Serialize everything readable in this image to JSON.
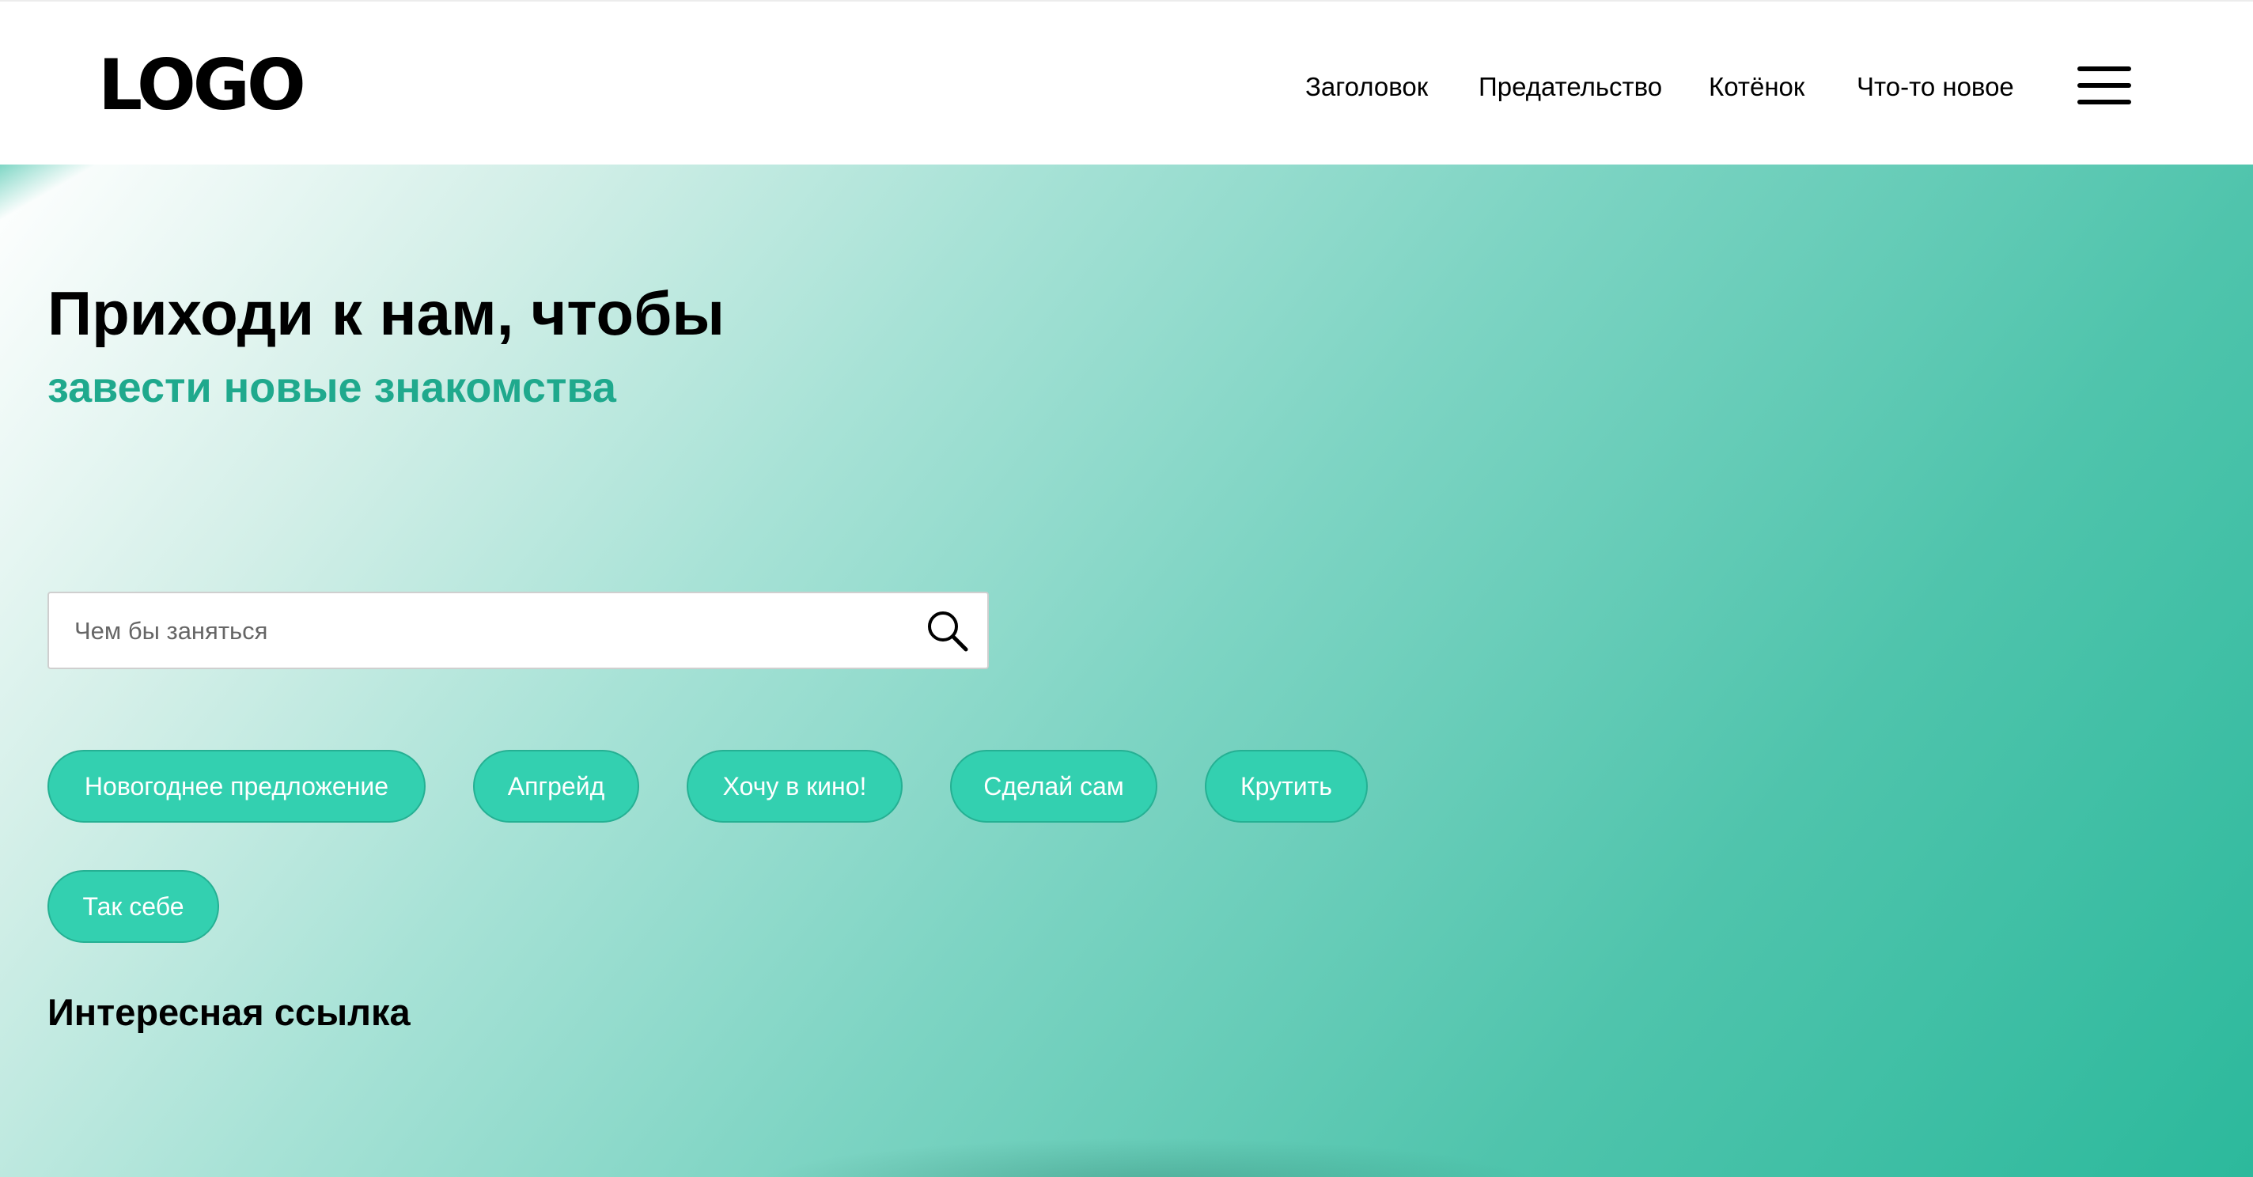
{
  "header": {
    "logo": "LOGO",
    "nav": [
      {
        "label": "Заголовок"
      },
      {
        "label": "Предательство"
      },
      {
        "label": "Котёнок"
      },
      {
        "label": "Что-то новое"
      }
    ],
    "menu_icon": "hamburger-menu-icon"
  },
  "hero": {
    "title": "Приходи к нам, чтобы",
    "subtitle": "завести новые знакомства",
    "search": {
      "placeholder": "Чем бы заняться",
      "value": "",
      "icon": "search-icon"
    },
    "tags": [
      {
        "label": "Новогоднее предложение"
      },
      {
        "label": "Апгрейд"
      },
      {
        "label": "Хочу в кино!"
      },
      {
        "label": "Сделай сам"
      },
      {
        "label": "Крутить"
      },
      {
        "label": "Так себе"
      }
    ],
    "link": "Интересная ссылка"
  },
  "colors": {
    "accent_text": "#1fa98d",
    "tag_background": "#33d0b0",
    "tag_border": "#25b093",
    "gradient_start": "#ffffff",
    "gradient_end": "#2cb99c"
  }
}
